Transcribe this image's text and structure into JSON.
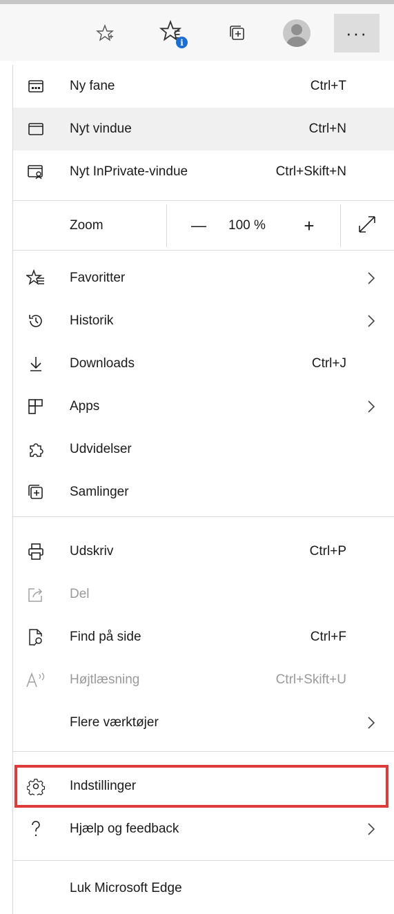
{
  "toolbar": {
    "more_label": "···",
    "icons": [
      "star-outline-icon",
      "favorites-info-icon",
      "collections-icon",
      "profile-avatar",
      "more-icon"
    ]
  },
  "menu": {
    "new_tab": {
      "label": "Ny fane",
      "shortcut": "Ctrl+T"
    },
    "new_window": {
      "label": "Nyt vindue",
      "shortcut": "Ctrl+N"
    },
    "new_inprivate": {
      "label": "Nyt InPrivate-vindue",
      "shortcut": "Ctrl+Skift+N"
    },
    "zoom": {
      "label": "Zoom",
      "minus": "—",
      "value": "100 %",
      "plus": "+"
    },
    "favorites": {
      "label": "Favoritter"
    },
    "history": {
      "label": "Historik"
    },
    "downloads": {
      "label": "Downloads",
      "shortcut": "Ctrl+J"
    },
    "apps": {
      "label": "Apps"
    },
    "extensions": {
      "label": "Udvidelser"
    },
    "collections": {
      "label": "Samlinger"
    },
    "print": {
      "label": "Udskriv",
      "shortcut": "Ctrl+P"
    },
    "share": {
      "label": "Del"
    },
    "find": {
      "label": "Find på side",
      "shortcut": "Ctrl+F"
    },
    "read_aloud": {
      "label": "Højtlæsning",
      "shortcut": "Ctrl+Skift+U"
    },
    "more_tools": {
      "label": "Flere værktøjer"
    },
    "settings": {
      "label": "Indstillinger"
    },
    "help": {
      "label": "Hjælp og feedback"
    },
    "close_edge": {
      "label": "Luk Microsoft Edge"
    }
  },
  "colors": {
    "highlight_border": "#e03b3b",
    "info_badge": "#1b6ed2",
    "disabled_text": "#9a9a9a"
  }
}
